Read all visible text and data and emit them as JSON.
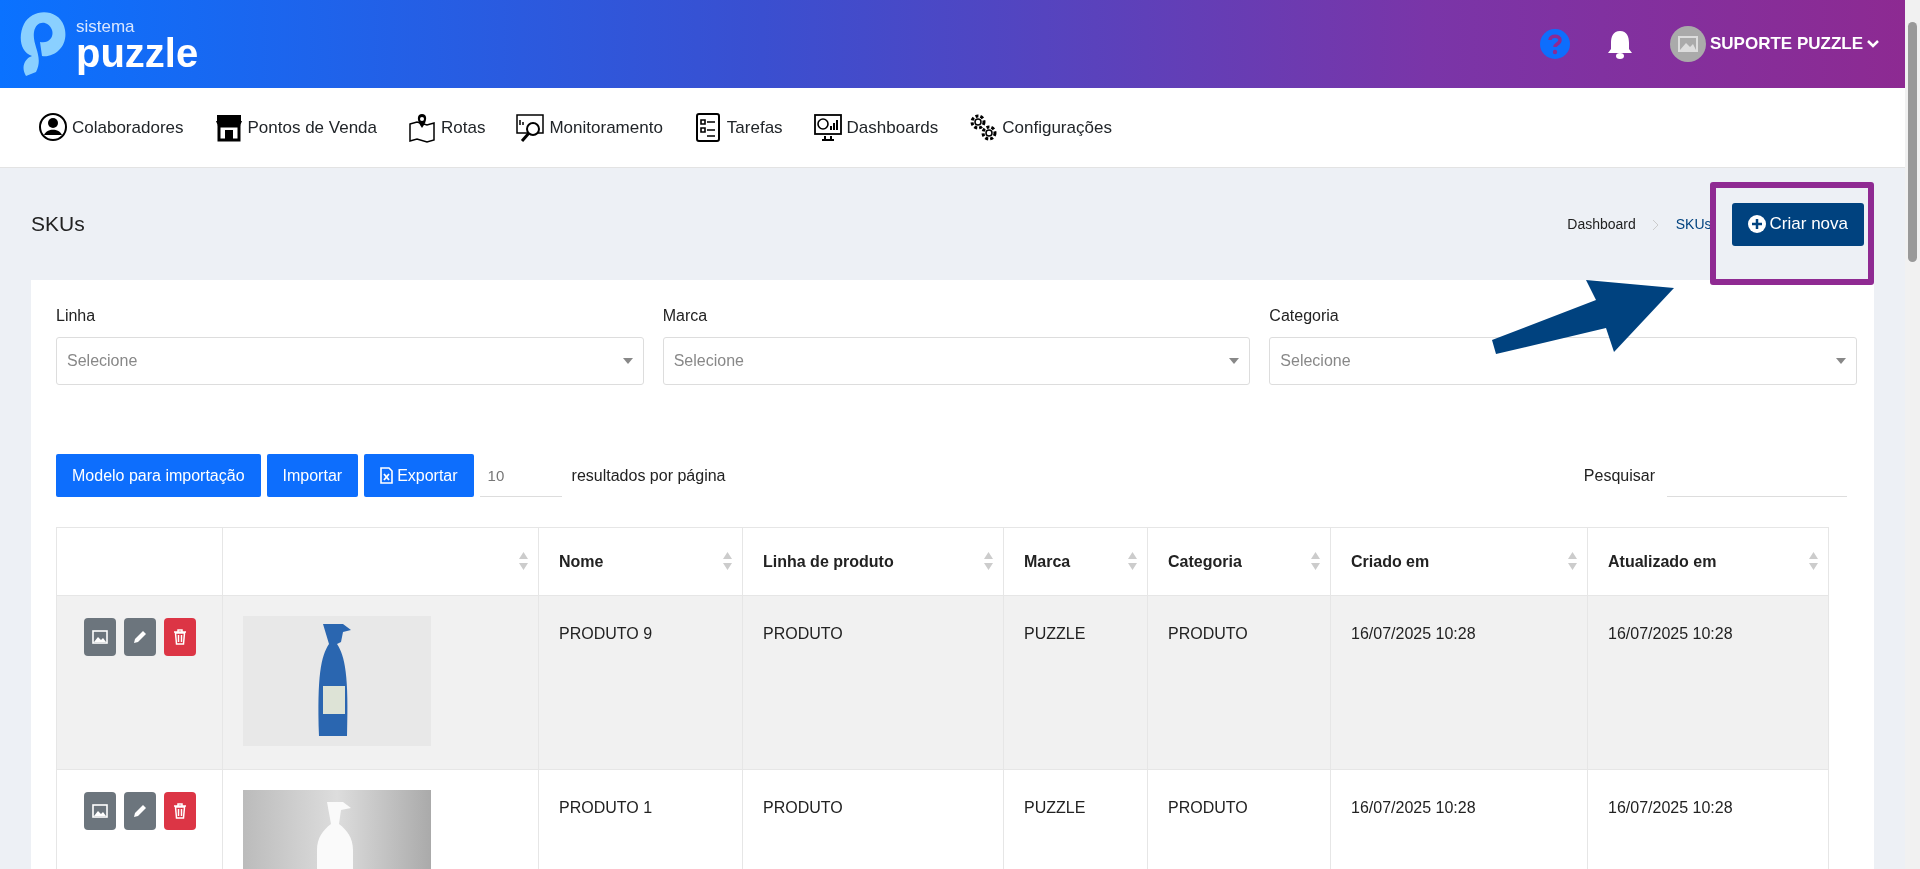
{
  "brand": {
    "small": "sistema",
    "big": "puzzle"
  },
  "user": {
    "name": "SUPORTE PUZZLE"
  },
  "nav": [
    {
      "label": "Colaboradores"
    },
    {
      "label": "Pontos de Venda"
    },
    {
      "label": "Rotas"
    },
    {
      "label": "Monitoramento"
    },
    {
      "label": "Tarefas"
    },
    {
      "label": "Dashboards"
    },
    {
      "label": "Configurações"
    }
  ],
  "page_title": "SKUs",
  "breadcrumb": [
    {
      "label": "Dashboard",
      "selected": false
    },
    {
      "label": "SKUs",
      "selected": true
    }
  ],
  "create_button": "Criar nova",
  "filters": [
    {
      "label": "Linha",
      "placeholder": "Selecione"
    },
    {
      "label": "Marca",
      "placeholder": "Selecione"
    },
    {
      "label": "Categoria",
      "placeholder": "Selecione"
    }
  ],
  "toolbar": {
    "buttons": [
      {
        "label": "Modelo para importação",
        "kind": "plain"
      },
      {
        "label": "Importar",
        "kind": "plain"
      },
      {
        "label": "Exportar",
        "kind": "excel"
      }
    ],
    "page_size": "10",
    "page_size_label": "resultados por página",
    "search_label": "Pesquisar"
  },
  "table": {
    "columns": [
      "",
      "",
      "Nome",
      "Linha de produto",
      "Marca",
      "Categoria",
      "Criado em",
      "Atualizado em"
    ],
    "rows": [
      {
        "cells": [
          "",
          "",
          "PRODUTO 9",
          "PRODUTO",
          "PUZZLE",
          "PRODUTO",
          "16/07/2025 10:28",
          "16/07/2025 10:28"
        ]
      },
      {
        "cells": [
          "",
          "",
          "PRODUTO 1",
          "PRODUTO",
          "PUZZLE",
          "PRODUTO",
          "16/07/2025 10:28",
          "16/07/2025 10:28"
        ]
      }
    ]
  }
}
